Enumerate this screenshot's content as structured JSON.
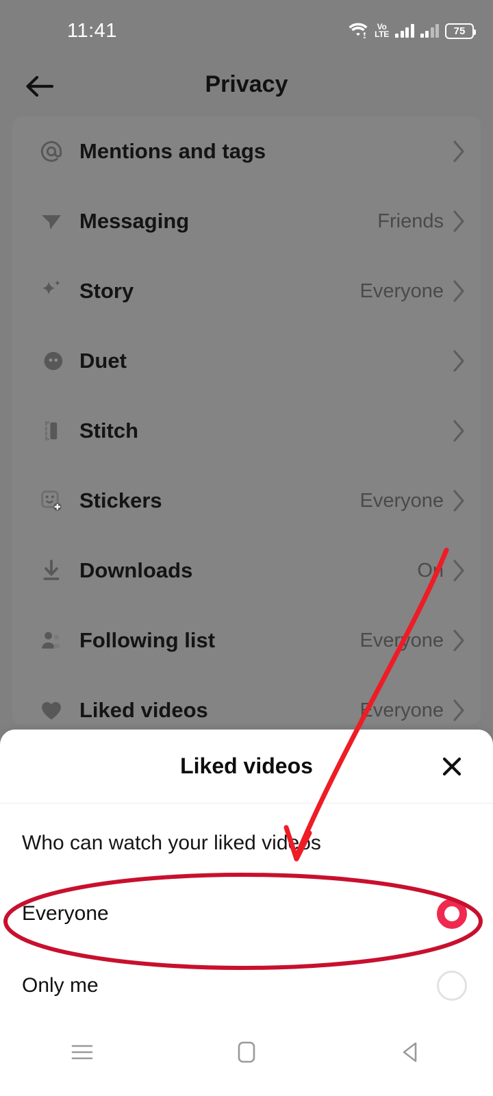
{
  "statusbar": {
    "time": "11:41",
    "wifi_icon": "wifi-icon",
    "volte_top": "Vo",
    "volte_bottom": "LTE",
    "signal_icon_1": "signal-bars-icon",
    "signal_icon_2": "signal-bars-secondary-icon",
    "battery_level": "75"
  },
  "header": {
    "back_icon": "back-arrow-icon",
    "title": "Privacy"
  },
  "settings_list": [
    {
      "icon": "at-mention-icon",
      "label": "Mentions and tags",
      "value": "",
      "chevron": "›"
    },
    {
      "icon": "paper-plane-icon",
      "label": "Messaging",
      "value": "Friends",
      "chevron": "›"
    },
    {
      "icon": "sparkle-icon",
      "label": "Story",
      "value": "Everyone",
      "chevron": "›"
    },
    {
      "icon": "duet-icon",
      "label": "Duet",
      "value": "",
      "chevron": "›"
    },
    {
      "icon": "stitch-icon",
      "label": "Stitch",
      "value": "",
      "chevron": "›"
    },
    {
      "icon": "sticker-icon",
      "label": "Stickers",
      "value": "Everyone",
      "chevron": "›"
    },
    {
      "icon": "download-icon",
      "label": "Downloads",
      "value": "On",
      "chevron": "›"
    },
    {
      "icon": "people-icon",
      "label": "Following list",
      "value": "Everyone",
      "chevron": "›"
    },
    {
      "icon": "heart-icon",
      "label": "Liked videos",
      "value": "Everyone",
      "chevron": "›"
    }
  ],
  "sheet": {
    "title": "Liked videos",
    "close_icon": "close-icon",
    "question": "Who can watch your liked videos",
    "options": [
      {
        "label": "Everyone",
        "selected": true,
        "radio_icon": "radio-selected-icon"
      },
      {
        "label": "Only me",
        "selected": false,
        "radio_icon": "radio-unselected-icon"
      }
    ]
  },
  "android_nav": {
    "recents_icon": "menu-recents-icon",
    "home_icon": "home-square-icon",
    "back_icon": "back-triangle-icon"
  },
  "annotations": {
    "arrow_color": "#ee1c25",
    "ellipse_color": "#c8102e",
    "arrow_target": "Everyone",
    "ellipse_target": "Everyone"
  },
  "colors": {
    "accent_pink": "#ef2950",
    "dim_overlay": "#808080",
    "sheet_bg": "#ffffff",
    "text_primary": "#111111",
    "text_secondary": "#4a4a4a"
  }
}
